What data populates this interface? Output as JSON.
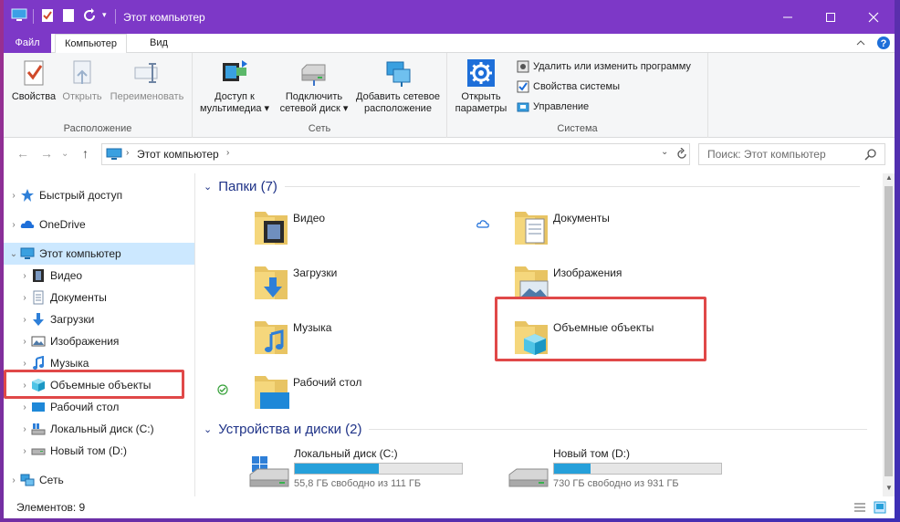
{
  "window": {
    "title": "Этот компьютер",
    "accent_color": "#7d38c7",
    "controls": [
      "minimize-icon",
      "maximize-icon",
      "close-icon"
    ]
  },
  "ribbon_tabs": {
    "file": "Файл",
    "computer": "Компьютер",
    "view": "Вид"
  },
  "ribbon": {
    "location": {
      "label": "Расположение",
      "properties": "Свойства",
      "open": "Открыть",
      "rename": "Переименовать"
    },
    "network": {
      "label": "Сеть",
      "media_access_1": "Доступ к",
      "media_access_2": "мультимедиа",
      "map_drive_1": "Подключить",
      "map_drive_2": "сетевой диск",
      "add_location_1": "Добавить сетевое",
      "add_location_2": "расположение"
    },
    "system": {
      "label": "Система",
      "open_settings_1": "Открыть",
      "open_settings_2": "параметры",
      "uninstall": "Удалить или изменить программу",
      "system_props": "Свойства системы",
      "manage": "Управление"
    }
  },
  "address": {
    "path": "Этот компьютер",
    "search_placeholder": "Поиск: Этот компьютер"
  },
  "nav_pane": {
    "quick_access": "Быстрый доступ",
    "onedrive": "OneDrive",
    "this_pc": "Этот компьютер",
    "items": [
      "Видео",
      "Документы",
      "Загрузки",
      "Изображения",
      "Музыка",
      "Объемные объекты",
      "Рабочий стол",
      "Локальный диск (C:)",
      "Новый том (D:)"
    ],
    "network": "Сеть"
  },
  "folders_section": {
    "title": "Папки (7)",
    "folders": [
      "Видео",
      "Документы",
      "Загрузки",
      "Изображения",
      "Музыка",
      "Объемные объекты",
      "Рабочий стол"
    ]
  },
  "drives_section": {
    "title": "Устройства и диски (2)",
    "drives": [
      {
        "name": "Локальный диск (C:)",
        "free_text": "55,8 ГБ свободно из 111 ГБ",
        "used_fraction": 0.5
      },
      {
        "name": "Новый том (D:)",
        "free_text": "730 ГБ свободно из 931 ГБ",
        "used_fraction": 0.22
      }
    ]
  },
  "status": {
    "items_count": "Элементов: 9"
  },
  "highlight_color": "#e04848"
}
